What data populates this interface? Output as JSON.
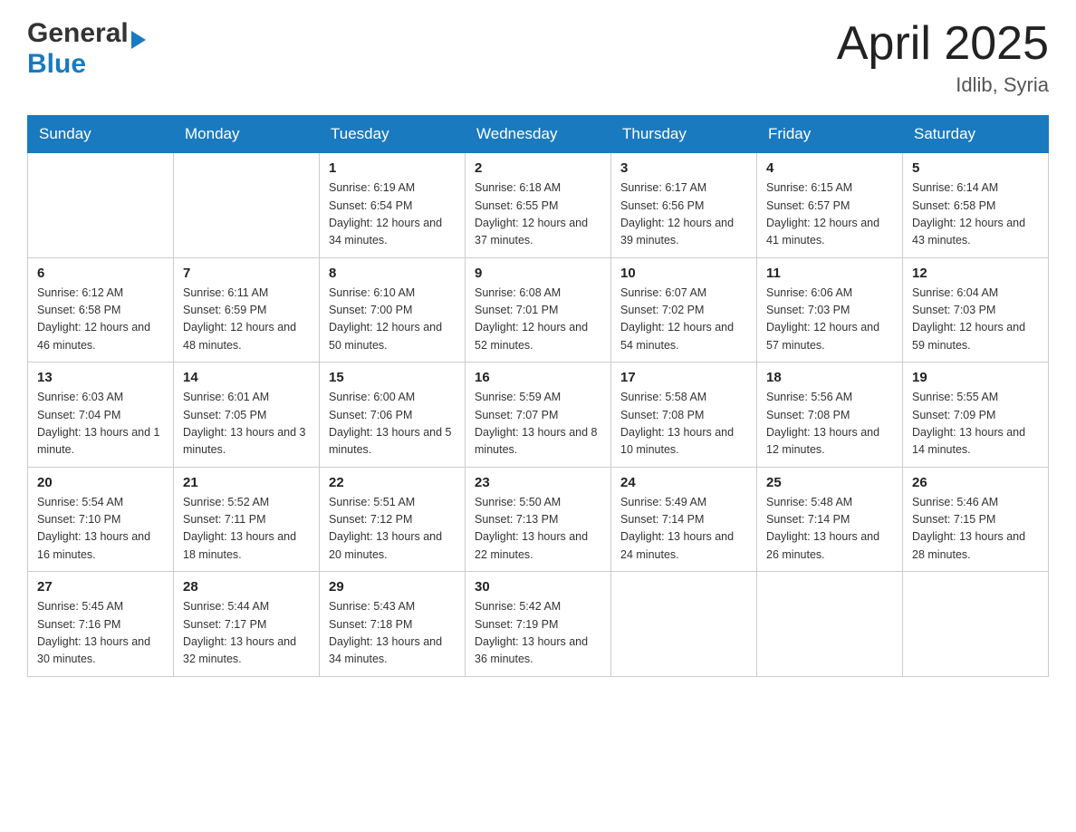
{
  "header": {
    "logo": {
      "general": "General",
      "arrow": "▶",
      "blue": "Blue"
    },
    "title": "April 2025",
    "location": "Idlib, Syria"
  },
  "days_of_week": [
    "Sunday",
    "Monday",
    "Tuesday",
    "Wednesday",
    "Thursday",
    "Friday",
    "Saturday"
  ],
  "weeks": [
    [
      {
        "day": "",
        "info": ""
      },
      {
        "day": "",
        "info": ""
      },
      {
        "day": "1",
        "info": "Sunrise: 6:19 AM\nSunset: 6:54 PM\nDaylight: 12 hours\nand 34 minutes."
      },
      {
        "day": "2",
        "info": "Sunrise: 6:18 AM\nSunset: 6:55 PM\nDaylight: 12 hours\nand 37 minutes."
      },
      {
        "day": "3",
        "info": "Sunrise: 6:17 AM\nSunset: 6:56 PM\nDaylight: 12 hours\nand 39 minutes."
      },
      {
        "day": "4",
        "info": "Sunrise: 6:15 AM\nSunset: 6:57 PM\nDaylight: 12 hours\nand 41 minutes."
      },
      {
        "day": "5",
        "info": "Sunrise: 6:14 AM\nSunset: 6:58 PM\nDaylight: 12 hours\nand 43 minutes."
      }
    ],
    [
      {
        "day": "6",
        "info": "Sunrise: 6:12 AM\nSunset: 6:58 PM\nDaylight: 12 hours\nand 46 minutes."
      },
      {
        "day": "7",
        "info": "Sunrise: 6:11 AM\nSunset: 6:59 PM\nDaylight: 12 hours\nand 48 minutes."
      },
      {
        "day": "8",
        "info": "Sunrise: 6:10 AM\nSunset: 7:00 PM\nDaylight: 12 hours\nand 50 minutes."
      },
      {
        "day": "9",
        "info": "Sunrise: 6:08 AM\nSunset: 7:01 PM\nDaylight: 12 hours\nand 52 minutes."
      },
      {
        "day": "10",
        "info": "Sunrise: 6:07 AM\nSunset: 7:02 PM\nDaylight: 12 hours\nand 54 minutes."
      },
      {
        "day": "11",
        "info": "Sunrise: 6:06 AM\nSunset: 7:03 PM\nDaylight: 12 hours\nand 57 minutes."
      },
      {
        "day": "12",
        "info": "Sunrise: 6:04 AM\nSunset: 7:03 PM\nDaylight: 12 hours\nand 59 minutes."
      }
    ],
    [
      {
        "day": "13",
        "info": "Sunrise: 6:03 AM\nSunset: 7:04 PM\nDaylight: 13 hours\nand 1 minute."
      },
      {
        "day": "14",
        "info": "Sunrise: 6:01 AM\nSunset: 7:05 PM\nDaylight: 13 hours\nand 3 minutes."
      },
      {
        "day": "15",
        "info": "Sunrise: 6:00 AM\nSunset: 7:06 PM\nDaylight: 13 hours\nand 5 minutes."
      },
      {
        "day": "16",
        "info": "Sunrise: 5:59 AM\nSunset: 7:07 PM\nDaylight: 13 hours\nand 8 minutes."
      },
      {
        "day": "17",
        "info": "Sunrise: 5:58 AM\nSunset: 7:08 PM\nDaylight: 13 hours\nand 10 minutes."
      },
      {
        "day": "18",
        "info": "Sunrise: 5:56 AM\nSunset: 7:08 PM\nDaylight: 13 hours\nand 12 minutes."
      },
      {
        "day": "19",
        "info": "Sunrise: 5:55 AM\nSunset: 7:09 PM\nDaylight: 13 hours\nand 14 minutes."
      }
    ],
    [
      {
        "day": "20",
        "info": "Sunrise: 5:54 AM\nSunset: 7:10 PM\nDaylight: 13 hours\nand 16 minutes."
      },
      {
        "day": "21",
        "info": "Sunrise: 5:52 AM\nSunset: 7:11 PM\nDaylight: 13 hours\nand 18 minutes."
      },
      {
        "day": "22",
        "info": "Sunrise: 5:51 AM\nSunset: 7:12 PM\nDaylight: 13 hours\nand 20 minutes."
      },
      {
        "day": "23",
        "info": "Sunrise: 5:50 AM\nSunset: 7:13 PM\nDaylight: 13 hours\nand 22 minutes."
      },
      {
        "day": "24",
        "info": "Sunrise: 5:49 AM\nSunset: 7:14 PM\nDaylight: 13 hours\nand 24 minutes."
      },
      {
        "day": "25",
        "info": "Sunrise: 5:48 AM\nSunset: 7:14 PM\nDaylight: 13 hours\nand 26 minutes."
      },
      {
        "day": "26",
        "info": "Sunrise: 5:46 AM\nSunset: 7:15 PM\nDaylight: 13 hours\nand 28 minutes."
      }
    ],
    [
      {
        "day": "27",
        "info": "Sunrise: 5:45 AM\nSunset: 7:16 PM\nDaylight: 13 hours\nand 30 minutes."
      },
      {
        "day": "28",
        "info": "Sunrise: 5:44 AM\nSunset: 7:17 PM\nDaylight: 13 hours\nand 32 minutes."
      },
      {
        "day": "29",
        "info": "Sunrise: 5:43 AM\nSunset: 7:18 PM\nDaylight: 13 hours\nand 34 minutes."
      },
      {
        "day": "30",
        "info": "Sunrise: 5:42 AM\nSunset: 7:19 PM\nDaylight: 13 hours\nand 36 minutes."
      },
      {
        "day": "",
        "info": ""
      },
      {
        "day": "",
        "info": ""
      },
      {
        "day": "",
        "info": ""
      }
    ]
  ]
}
